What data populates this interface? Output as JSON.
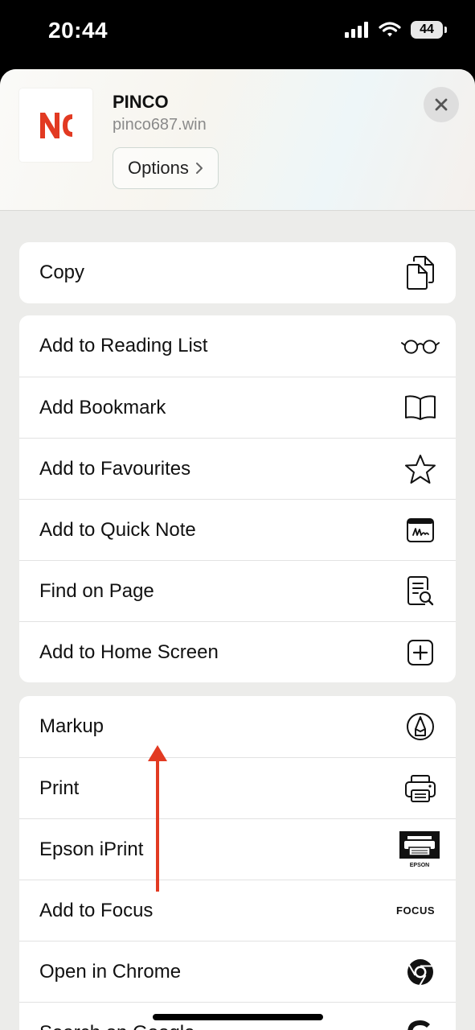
{
  "status_bar": {
    "time": "20:44",
    "battery": "44"
  },
  "header": {
    "site_title": "PINCO",
    "site_url": "pinco687.win",
    "options_label": "Options",
    "logo_text": "NC",
    "logo_color": "#e23a22"
  },
  "groups": [
    {
      "items": [
        {
          "label": "Copy",
          "icon": "copy-icon"
        }
      ]
    },
    {
      "items": [
        {
          "label": "Add to Reading List",
          "icon": "glasses-icon"
        },
        {
          "label": "Add Bookmark",
          "icon": "book-icon"
        },
        {
          "label": "Add to Favourites",
          "icon": "star-icon"
        },
        {
          "label": "Add to Quick Note",
          "icon": "quick-note-icon"
        },
        {
          "label": "Find on Page",
          "icon": "find-on-page-icon"
        },
        {
          "label": "Add to Home Screen",
          "icon": "add-square-icon"
        }
      ]
    },
    {
      "items": [
        {
          "label": "Markup",
          "icon": "markup-pen-icon"
        },
        {
          "label": "Print",
          "icon": "printer-icon"
        },
        {
          "label": "Epson iPrint",
          "icon": "epson-icon",
          "icon_text": "EPSON"
        },
        {
          "label": "Add to Focus",
          "icon": "focus-icon",
          "icon_text": "FOCUS"
        },
        {
          "label": "Open in Chrome",
          "icon": "chrome-icon"
        },
        {
          "label": "Search on Google",
          "icon": "google-icon"
        }
      ]
    }
  ],
  "accent_color": "#e23a22"
}
